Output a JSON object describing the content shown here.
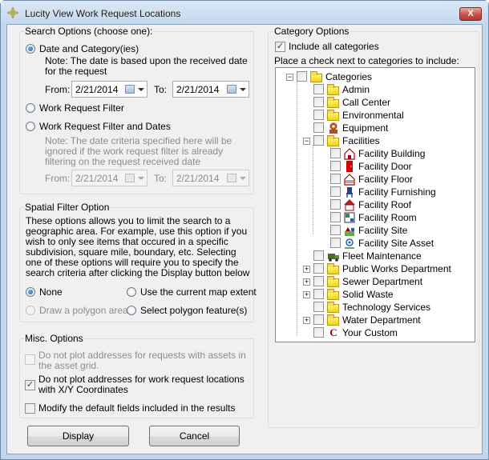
{
  "window": {
    "title": "Lucity View Work Request Locations",
    "close_glyph": "X"
  },
  "search": {
    "group_title": "Search Options (choose one):",
    "opt_date_cat": "Date and Category(ies)",
    "note1": [
      "Note:  The date is based upon the received date",
      "for the request"
    ],
    "from_label": "From:",
    "to_label": "To:",
    "from_date": "2/21/2014",
    "to_date": "2/21/2014",
    "opt_filter": "Work Request Filter",
    "opt_filter_dates": "Work Request Filter and Dates",
    "note2": [
      "Note:  The date criteria specified here will be",
      "ignored if the work request filter is already",
      "filtering on the request received date"
    ],
    "from_label2": "From:",
    "to_label2": "To:",
    "from_date2": "2/21/2014",
    "to_date2": "2/21/2014"
  },
  "spatial": {
    "group_title": "Spatial Filter Option",
    "desc": [
      "These options allows you to limit the search to a",
      "geographic area.  For example, use this option if you",
      "wish to only see items that occured in a specific",
      "subdivision, square mile, boundary, etc.  Selecting",
      "one of these options will require you to specify the",
      "search criteria after clicking the Display button below"
    ],
    "opt_none": "None",
    "opt_extent": "Use the current map extent",
    "opt_polygon_area": "Draw a polygon area",
    "opt_polygon_feature": "Select polygon feature(s)"
  },
  "misc": {
    "group_title": "Misc. Options",
    "opt1": [
      "Do not plot addresses for requests with assets in",
      "the asset grid."
    ],
    "opt2": [
      "Do not plot addresses for work request locations",
      "with X/Y Coordinates"
    ],
    "opt3": "Modify the default fields included in the results",
    "check_glyph": "✓"
  },
  "buttons": {
    "display": "Display",
    "cancel": "Cancel"
  },
  "category": {
    "group_title": "Category Options",
    "include_all": "Include all categories",
    "instruction": "Place a check next to categories to include:",
    "tree": {
      "root": "Categories",
      "admin": "Admin",
      "call_center": "Call Center",
      "environmental": "Environmental",
      "equipment": "Equipment",
      "facilities": "Facilities",
      "facility_building": "Facility Building",
      "facility_door": "Facility Door",
      "facility_floor": "Facility Floor",
      "facility_furnishing": "Facility Furnishing",
      "facility_roof": "Facility Roof",
      "facility_room": "Facility Room",
      "facility_site": "Facility Site",
      "facility_site_asset": "Facility Site Asset",
      "fleet_maintenance": "Fleet Maintenance",
      "public_works": "Public Works Department",
      "sewer": "Sewer Department",
      "solid_waste": "Solid Waste",
      "technology": "Technology Services",
      "water": "Water Department",
      "your_custom": "Your Custom",
      "your_custom_glyph": "C",
      "collapse_glyph": "−",
      "expand_glyph": "+"
    }
  },
  "colors": {
    "accent": "#1d56a0",
    "folder": "#f2d21c",
    "close": "#c75050"
  }
}
